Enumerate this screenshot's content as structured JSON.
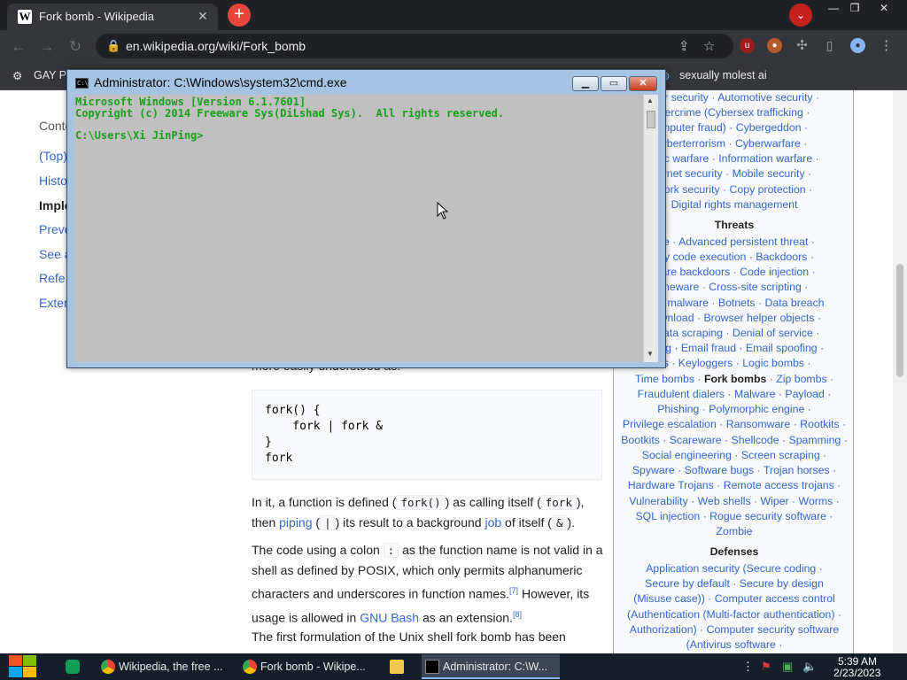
{
  "browser": {
    "tab_title": "Fork bomb - Wikipedia",
    "tab_favicon": "W",
    "url": "en.wikipedia.org/wiki/Fork_bomb",
    "bookmark_left": "GAY P",
    "bookmark_right": "sexually molest ai",
    "accent_color": "#e8453c"
  },
  "cmd": {
    "title": "Administrator: C:\\Windows\\system32\\cmd.exe",
    "icon_text": "C:\\",
    "line1": "Microsoft Windows [Version 6.1.7601]",
    "line2": "Copyright (c) 2014 Freeware Sys(DiLshad Sys).  All rights reserved.",
    "line3": "",
    "line4": "C:\\Users\\Xi JinPing>",
    "text_color": "#18a018"
  },
  "toc": {
    "title": "Conte",
    "items": [
      "(Top)",
      "Histo",
      "Imple",
      "Preve",
      "See a",
      "Refe",
      "Exter"
    ]
  },
  "article": {
    "code": "fork() {\n    fork | fork &\n}\nfork",
    "partial_line": "more easily understood as:",
    "p1_a": "In it, a function is defined (",
    "p1_code1": "fork()",
    "p1_b": ") as calling itself (",
    "p1_code2": "fork",
    "p1_c": "),",
    "p1_d": "then ",
    "p1_link1": "piping",
    "p1_e": " (",
    "p1_code3": "|",
    "p1_f": ") its result to a background ",
    "p1_link2": "job",
    "p1_g": " of itself (",
    "p1_code4": "&",
    "p1_h": ").",
    "p2_a": "The code using a colon ",
    "p2_code": ":",
    "p2_b": " as the function name is not valid in a shell as defined by POSIX, which only permits alphanumeric characters and underscores in function names.",
    "p2_ref1": "[7]",
    "p2_c": " However, its usage is allowed in ",
    "p2_link": "GNU Bash",
    "p2_d": " as an extension.",
    "p2_ref2": "[8]",
    "p3": "The first formulation of the Unix shell fork bomb has been"
  },
  "navbox": {
    "lines": [
      "uter security · Automotive security ·",
      "bercrime (Cybersex trafficking ·",
      "mputer fraud) · Cybergeddon ·",
      "yberterrorism · Cyberwarfare ·",
      "onic warfare · Information warfare ·",
      "ernet security · Mobile security ·",
      "work security · Copy protection ·",
      "Digital rights management"
    ],
    "threats_head": "Threats",
    "threats": [
      "are · Advanced persistent threat ·",
      "ary code execution · Backdoors ·",
      "ware backdoors · Code injection ·",
      "meware · Cross-site scripting ·",
      "king malware · Botnets · Data breach",
      "download · Browser helper objects ·",
      "· Data scraping · Denial of service ·",
      "pping · Email fraud · Email spoofing ·",
      "its · Keyloggers · Logic bombs ·"
    ],
    "fork_line_a": "Time bombs · ",
    "fork_line_bold": "Fork bombs",
    "fork_line_b": " · Zip bombs ·",
    "threats2": [
      "Fraudulent dialers · Malware · Payload ·",
      "Phishing · Polymorphic engine ·",
      "Privilege escalation · Ransomware · Rootkits ·",
      "Bootkits · Scareware · Shellcode · Spamming ·",
      "Social engineering · Screen scraping ·",
      "Spyware · Software bugs · Trojan horses ·",
      "Hardware Trojans · Remote access trojans ·",
      "Vulnerability · Web shells · Wiper · Worms ·",
      "SQL injection · Rogue security software ·",
      "Zombie"
    ],
    "defenses_head": "Defenses",
    "defenses": [
      "Application security (Secure coding ·",
      "Secure by default · Secure by design",
      "(Misuse case)) · Computer access control",
      "(Authentication (Multi-factor authentication) ·",
      "Authorization) · Computer security software",
      "(Antivirus software ·"
    ]
  },
  "taskbar": {
    "items": [
      "Wikipedia, the free ...",
      "Fork bomb - Wikipe...",
      "Administrator: C:\\W..."
    ],
    "time": "5:39 AM",
    "date": "2/23/2023"
  }
}
